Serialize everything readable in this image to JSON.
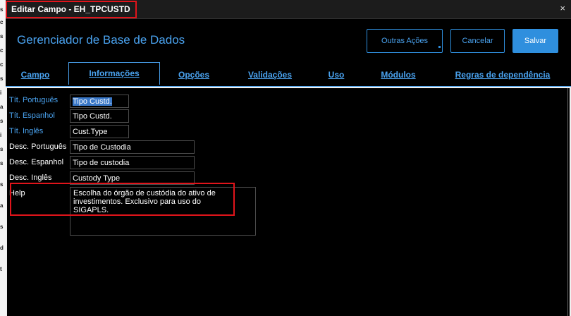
{
  "window": {
    "title": "Editar Campo - EH_TPCUSTD",
    "close_icon": "×"
  },
  "header": {
    "app_title": "Gerenciador de Base de Dados",
    "buttons": {
      "other_actions": "Outras Ações",
      "cancel": "Cancelar",
      "save": "Salvar"
    }
  },
  "tabs": [
    {
      "label": "Campo",
      "active": false
    },
    {
      "label": "Informações",
      "active": true
    },
    {
      "label": "Opções",
      "active": false
    },
    {
      "label": "Validações",
      "active": false
    },
    {
      "label": "Uso",
      "active": false
    },
    {
      "label": "Módulos",
      "active": false
    },
    {
      "label": "Regras de dependência",
      "active": false
    }
  ],
  "form": {
    "tit_portugues": {
      "label": "Tít. Português",
      "value": "Tipo Custd."
    },
    "tit_espanhol": {
      "label": "Tít. Espanhol",
      "value": "Tipo Custd."
    },
    "tit_ingles": {
      "label": "Tít. Inglês",
      "value": "Cust.Type"
    },
    "desc_portugues": {
      "label": "Desc. Português",
      "value": "Tipo de Custodia"
    },
    "desc_espanhol": {
      "label": "Desc. Espanhol",
      "value": "Tipo de custodia"
    },
    "desc_ingles": {
      "label": "Desc. Inglês",
      "value": "Custody Type"
    },
    "help": {
      "label": "Help",
      "line1": "Escolha do órgão de custódia do ativo de",
      "line2": "investimentos. Exclusivo para uso do",
      "line3": "SIGAPLS."
    }
  },
  "left_strip_glyphs": [
    "s",
    "c",
    "s",
    "c",
    "c",
    "s",
    "i",
    "a",
    "s",
    "i",
    "s",
    "s",
    "s",
    "a",
    "s",
    "d",
    "t"
  ],
  "colors": {
    "accent": "#2f8fde",
    "link": "#4aa3f0",
    "highlight": "#e0141b",
    "background": "#000000"
  }
}
